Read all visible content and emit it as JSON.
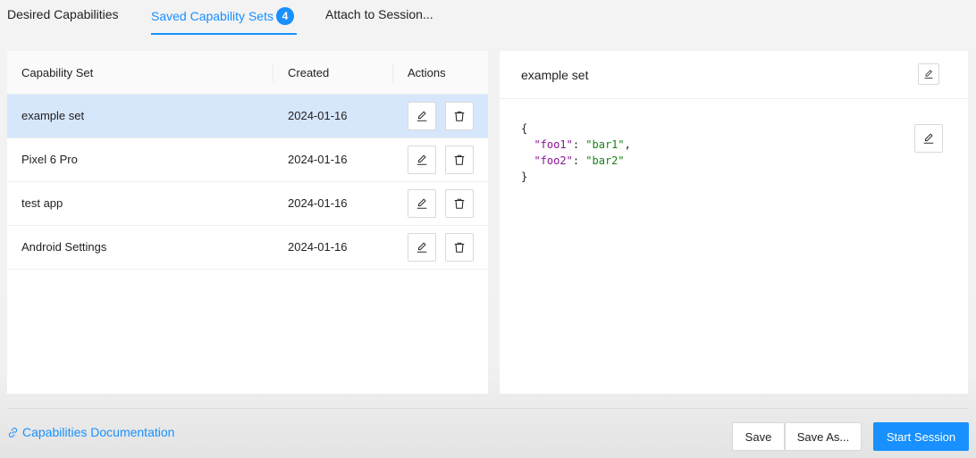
{
  "tabs": [
    {
      "label": "Desired Capabilities",
      "active": false
    },
    {
      "label": "Saved Capability Sets",
      "active": true,
      "badge": "4"
    },
    {
      "label": "Attach to Session...",
      "active": false
    }
  ],
  "table": {
    "columns": [
      "Capability Set",
      "Created",
      "Actions"
    ],
    "rows": [
      {
        "name": "example set",
        "created": "2024-01-16",
        "selected": true
      },
      {
        "name": "Pixel 6 Pro",
        "created": "2024-01-16",
        "selected": false
      },
      {
        "name": "test app",
        "created": "2024-01-16",
        "selected": false
      },
      {
        "name": "Android Settings",
        "created": "2024-01-16",
        "selected": false
      }
    ],
    "action_icons": [
      "edit-icon",
      "delete-icon"
    ]
  },
  "detail": {
    "title": "example set",
    "json_open": "{",
    "json_close": "}",
    "entries": [
      {
        "key": "\"foo1\"",
        "value": "\"bar1\"",
        "comma": ","
      },
      {
        "key": "\"foo2\"",
        "value": "\"bar2\"",
        "comma": ""
      }
    ]
  },
  "footer": {
    "doc_link": "Capabilities Documentation",
    "save": "Save",
    "save_as": "Save As...",
    "start_session": "Start Session"
  },
  "colors": {
    "accent": "#1890ff",
    "selected_row": "#d6e6fb",
    "json_key": "#881391",
    "json_value": "#1a7f1a"
  }
}
